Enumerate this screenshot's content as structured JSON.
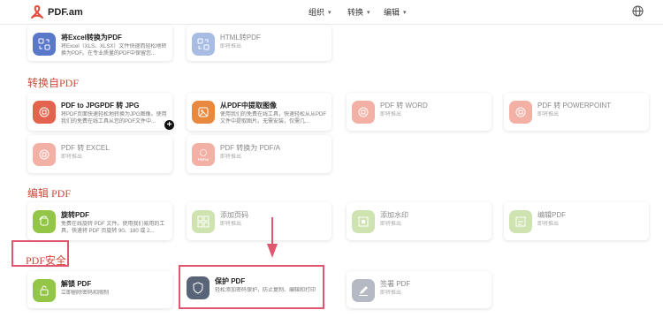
{
  "header": {
    "brand": "PDF.am",
    "nav": [
      {
        "label": "组织"
      },
      {
        "label": "转换"
      },
      {
        "label": "编辑"
      }
    ],
    "chevron": "▾",
    "brand_color": "#e54b3c",
    "globe_icon": "globe-icon"
  },
  "sections": {
    "convert_from": "转换自PDF",
    "edit": "编辑 PDF",
    "security": "PDF安全"
  },
  "cards": {
    "excel_to_pdf": {
      "title": "将Excel转换为PDF",
      "desc": "将Excel（XLS、XLSX）文件快速而轻松地转换为PDF。在专业质量的PDF中保留您..."
    },
    "html_to_pdf": {
      "title": "HTML转PDF",
      "desc": "即将推出"
    },
    "pdf_to_jpg": {
      "title": "PDF to JPGPDF 转 JPG",
      "desc": "将PDF页面快速轻松地转换为JPG图像。使用我们的免费在线工具从您的PDF文件中..."
    },
    "extract_images": {
      "title": "从PDF中提取图像",
      "desc": "使用我们的免费在线工具，快速轻松从从PDF文件中提取图片。无需安装，仅需几..."
    },
    "pdf_to_word": {
      "title": "PDF 转 WORD",
      "desc": "即将推出"
    },
    "pdf_to_ppt": {
      "title": "PDF 转 POWERPOINT",
      "desc": "即将推出"
    },
    "pdf_to_excel": {
      "title": "PDF 转 EXCEL",
      "desc": "即将推出"
    },
    "pdf_to_pdfa": {
      "title": "PDF 转换为 PDF/A",
      "desc": "即将推出",
      "icon_text": "PDF/A"
    },
    "rotate_pdf": {
      "title": "旋转PDF",
      "desc": "免费在线旋转 PDF 文件。使用我们易用的工具，快速将 PDF 页旋转 90、180 或 2..."
    },
    "add_page_numbers": {
      "title": "添加页码",
      "desc": "即将推出"
    },
    "add_watermark": {
      "title": "添加水印",
      "desc": "即将推出"
    },
    "edit_pdf": {
      "title": "编辑PDF",
      "desc": "即将推出"
    },
    "unlock_pdf": {
      "title": "解锁 PDF",
      "desc": "立即删除密码和限制"
    },
    "protect_pdf": {
      "title": "保护 PDF",
      "desc": "轻松添加密码保护，防止复制、编辑和打印"
    },
    "sign_pdf": {
      "title": "签署 PDF",
      "desc": "即将推出"
    }
  },
  "colors": {
    "section_red": "#cc4a3a",
    "highlight": "#e0566f",
    "blue_icon": "#5a78c9",
    "red_icon": "#e4634e",
    "orange_icon": "#e9893f",
    "green_icon": "#93c547",
    "slate_icon": "#5a6478"
  }
}
